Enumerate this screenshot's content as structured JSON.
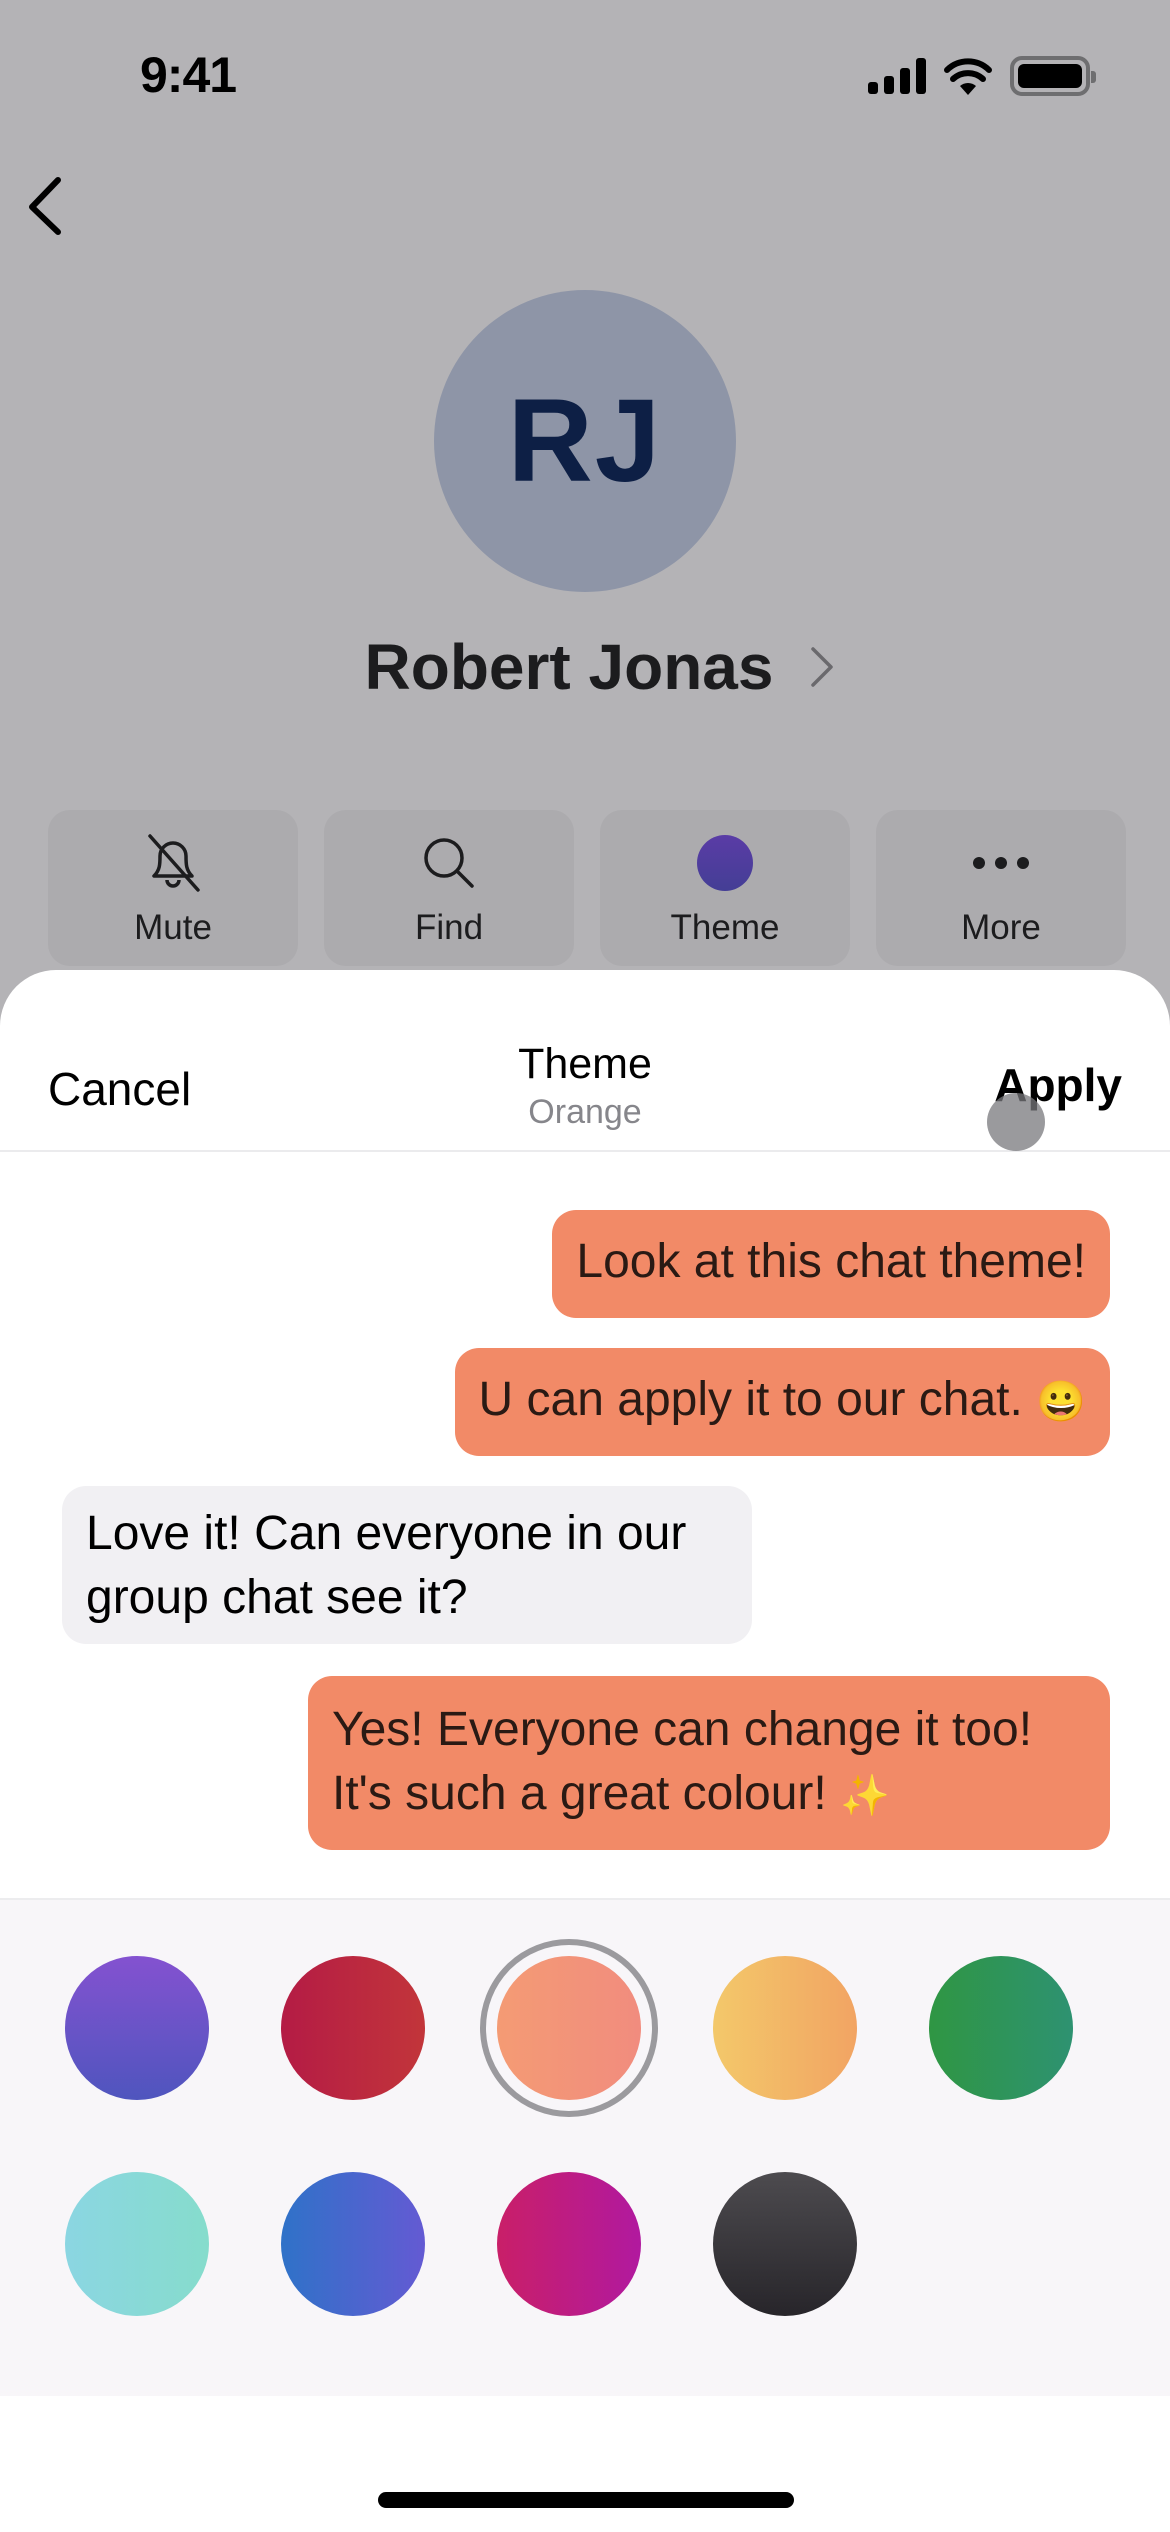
{
  "status_bar": {
    "time": "9:41",
    "icons": [
      "signal-icon",
      "wifi-icon",
      "battery-icon"
    ]
  },
  "nav": {
    "back_icon": "chevron-left-icon"
  },
  "profile": {
    "initials": "RJ",
    "name": "Robert Jonas",
    "avatar_color": "#8e95a7",
    "initials_color": "#0d1f45"
  },
  "actions": [
    {
      "label": "Mute",
      "icon": "bell-slash-icon"
    },
    {
      "label": "Find",
      "icon": "search-icon"
    },
    {
      "label": "Theme",
      "icon": "theme-dot-icon",
      "color": "#4f3da0"
    },
    {
      "label": "More",
      "icon": "ellipsis-icon"
    }
  ],
  "sheet": {
    "cancel_label": "Cancel",
    "title": "Theme",
    "subtitle": "Orange",
    "apply_label": "Apply"
  },
  "messages": [
    {
      "direction": "outgoing",
      "text": "Look at this chat theme!"
    },
    {
      "direction": "outgoing",
      "text": "U can apply it to our chat.",
      "emoji": "😀"
    },
    {
      "direction": "incoming",
      "text": "Love it! Can everyone in our group chat see it?"
    },
    {
      "direction": "outgoing",
      "text": "Yes! Everyone can change it too! It's such a great colour!",
      "emoji": "✨"
    }
  ],
  "theme_colors": {
    "outgoing_bubble": "#f28a67",
    "incoming_bubble": "#f1f0f3"
  },
  "swatches": [
    {
      "name": "Purple",
      "from": "#8452d0",
      "to": "#4f55be",
      "selected": false
    },
    {
      "name": "Red",
      "from": "#b41b45",
      "to": "#c2353a",
      "selected": false
    },
    {
      "name": "Orange",
      "from": "#f49b74",
      "to": "#f18c7e",
      "selected": true
    },
    {
      "name": "Yellow",
      "from": "#f3c86a",
      "to": "#f2a463",
      "selected": false
    },
    {
      "name": "Green",
      "from": "#2f9643",
      "to": "#2e9271",
      "selected": false
    },
    {
      "name": "Teal",
      "from": "#8bd6e2",
      "to": "#86dccc",
      "selected": false
    },
    {
      "name": "Blue",
      "from": "#2f72c8",
      "to": "#645ad3",
      "selected": false
    },
    {
      "name": "Magenta",
      "from": "#c91f68",
      "to": "#b1199f",
      "selected": false
    },
    {
      "name": "Dark",
      "from": "#4d4b4f",
      "to": "#27252a",
      "selected": false
    }
  ]
}
